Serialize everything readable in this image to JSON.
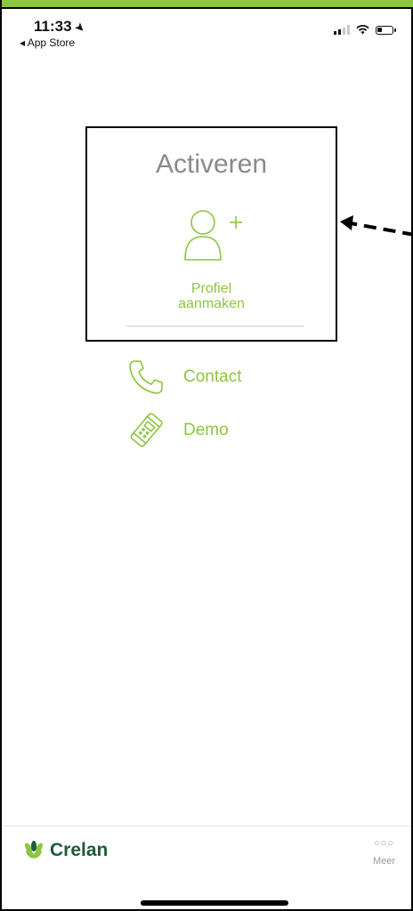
{
  "status_bar": {
    "time": "11:33",
    "back_app": "◂ App Store"
  },
  "activation": {
    "title": "Activeren",
    "profile_line1": "Profiel",
    "profile_line2": "aanmaken"
  },
  "menu": [
    {
      "label": "Contact",
      "icon": "phone-icon"
    },
    {
      "label": "Demo",
      "icon": "demo-phone-icon"
    }
  ],
  "footer": {
    "brand": "Crelan",
    "more_label": "Meer"
  },
  "colors": {
    "accent": "#8cc63f",
    "brand": "#1e5a3c",
    "title_gray": "#8a8a8a"
  }
}
